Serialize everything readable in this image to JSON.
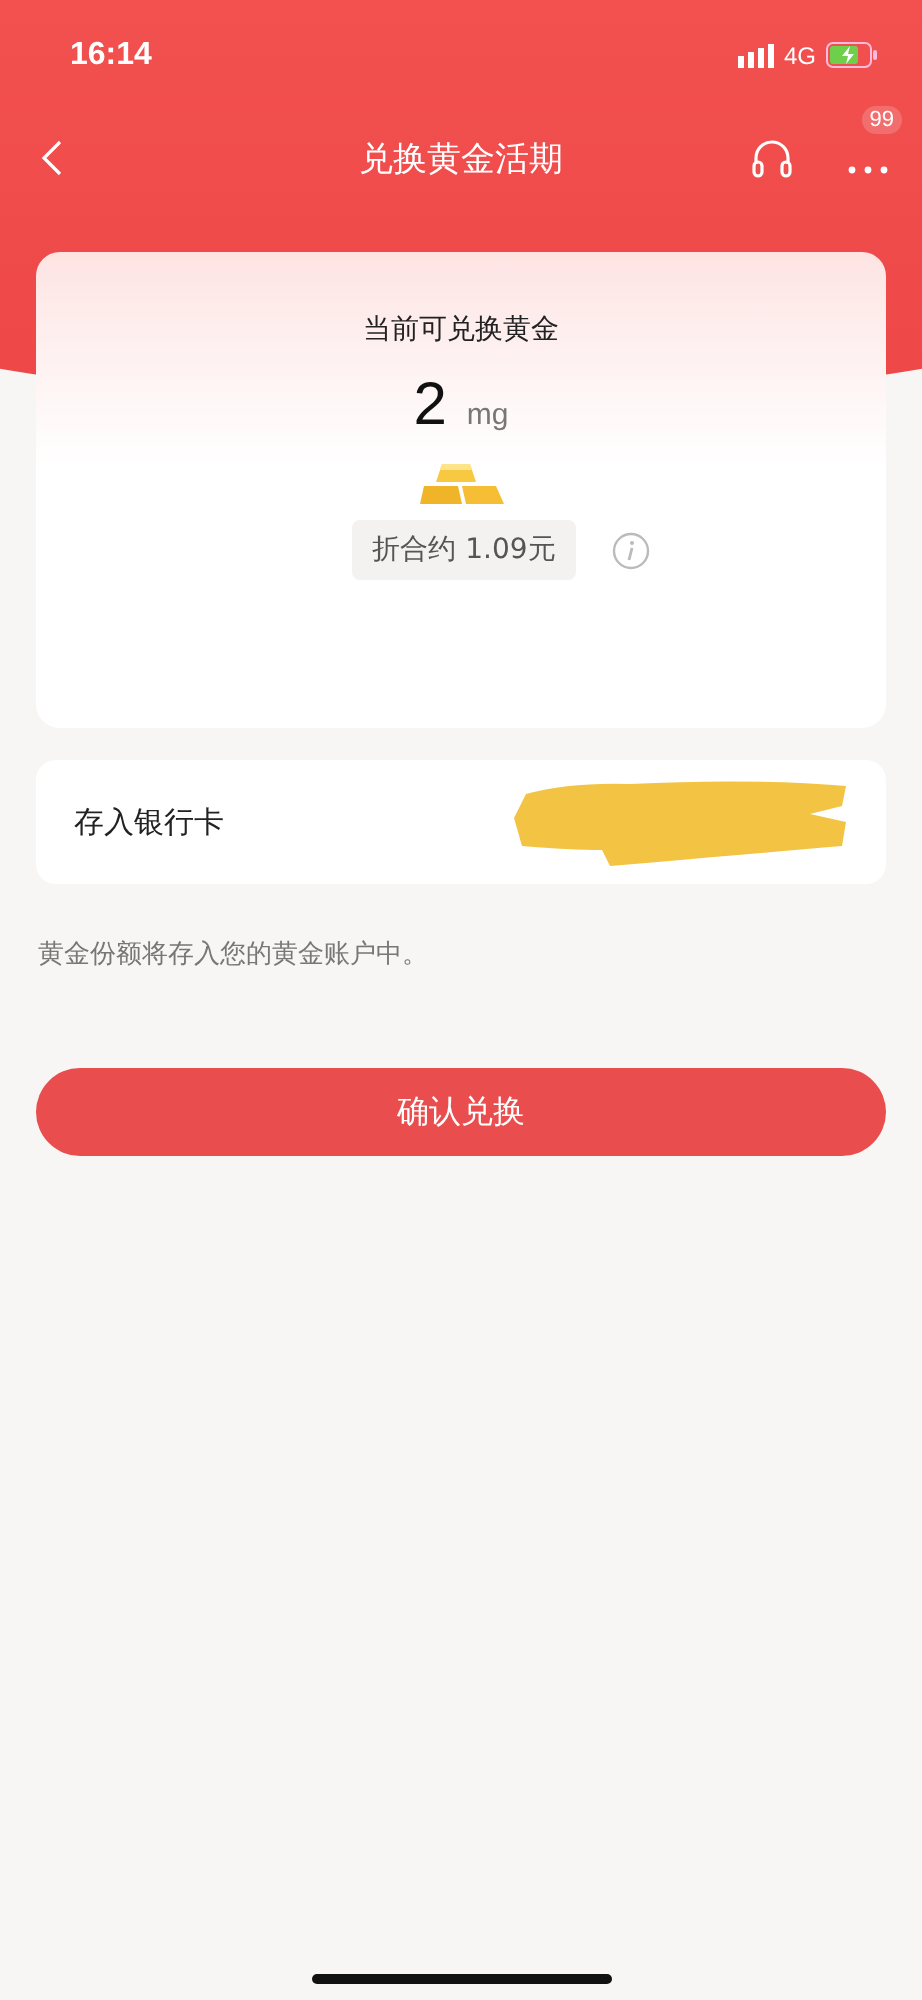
{
  "status_bar": {
    "time": "16:14",
    "network": "4G"
  },
  "nav": {
    "title": "兑换黄金活期",
    "badge": "99"
  },
  "card": {
    "label": "当前可兑换黄金",
    "amount": "2",
    "unit": "mg",
    "equivalent": "折合约 1.09元"
  },
  "bank_row": {
    "label": "存入银行卡",
    "redacted": true
  },
  "note": "黄金份额将存入您的黄金账户中。",
  "confirm_button": "确认兑换"
}
